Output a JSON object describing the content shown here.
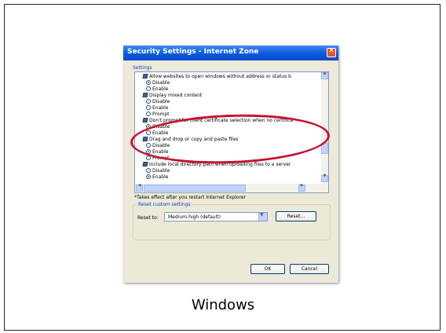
{
  "dialog": {
    "title": "Security Settings - Internet Zone",
    "group_label": "Settings",
    "settings_list": [
      {
        "type": "category",
        "label": "Allow websites to open windows without address or status b"
      },
      {
        "type": "option",
        "label": "Disable",
        "selected": true
      },
      {
        "type": "option",
        "label": "Enable",
        "selected": false
      },
      {
        "type": "category",
        "label": "Display mixed content"
      },
      {
        "type": "option",
        "label": "Disable",
        "selected": false
      },
      {
        "type": "option",
        "label": "Enable",
        "selected": false
      },
      {
        "type": "option",
        "label": "Prompt",
        "selected": false
      },
      {
        "type": "category",
        "label": "Don't prompt for client certificate selection when no certifica"
      },
      {
        "type": "option",
        "label": "Disable",
        "selected": true
      },
      {
        "type": "option",
        "label": "Enable",
        "selected": false
      },
      {
        "type": "category",
        "label": "Drag and drop or copy and paste files"
      },
      {
        "type": "option",
        "label": "Disable",
        "selected": false
      },
      {
        "type": "option",
        "label": "Enable",
        "selected": true
      },
      {
        "type": "option",
        "label": "Prompt",
        "selected": false
      },
      {
        "type": "category",
        "label": "Include local directory path when uploading files to a server"
      },
      {
        "type": "option",
        "label": "Disable",
        "selected": false
      },
      {
        "type": "option",
        "label": "Enable",
        "selected": true
      }
    ],
    "note": "*Takes effect after you restart Internet Explorer",
    "reset_group_label": "Reset custom settings",
    "reset_to_label": "Reset to:",
    "reset_select_value": "Medium-high (default)",
    "reset_button": "Reset...",
    "ok_button": "OK",
    "cancel_button": "Cancel"
  },
  "caption": "Windows",
  "colors": {
    "titlebar": "#0a5ae0",
    "dialog_bg": "#ece9d8",
    "highlight_ellipse": "#c8102e",
    "group_label": "#0046d5"
  }
}
